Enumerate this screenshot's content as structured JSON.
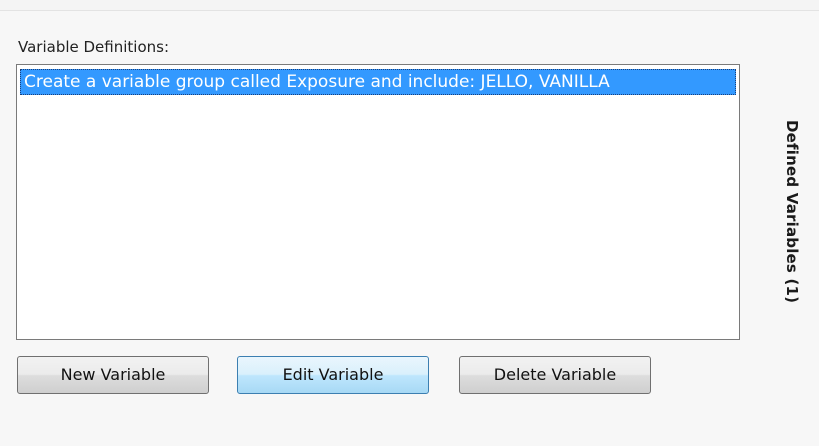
{
  "variable_definitions": {
    "label": "Variable Definitions:",
    "items": [
      {
        "text": "Create a variable group called Exposure and include: JELLO, VANILLA",
        "selected": true
      }
    ]
  },
  "buttons": {
    "new_label": "New Variable",
    "edit_label": "Edit Variable",
    "delete_label": "Delete Variable"
  },
  "side_panel": {
    "title": "Defined Variables (1)"
  },
  "colors": {
    "selection": "#3399ff",
    "panel_background": "#f7f7f7",
    "hot_button": "#bee6fd"
  }
}
